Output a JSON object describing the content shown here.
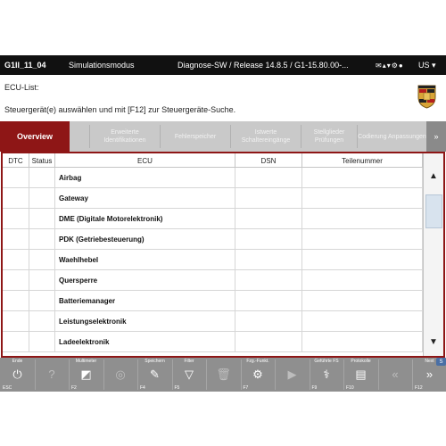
{
  "statusbar": {
    "vehicle": "G1II_11_04",
    "mode": "Simulationsmodus",
    "version": "Diagnose-SW / Release 14.8.5 / G1-15.80.00-...",
    "icons": "✉▴▾⚙●",
    "region": "US ▾"
  },
  "header": {
    "title": "ECU-List:",
    "instruction": "Steuergerät(e) auswählen und mit [F12] zur Steuergeräte-Suche.",
    "logo": "porsche-crest"
  },
  "tabs": [
    {
      "label": "Overview",
      "active": true
    },
    {
      "label": "",
      "active": false
    },
    {
      "label": "Erweiterte Identifikationen",
      "active": false
    },
    {
      "label": "Fehlerspeicher",
      "active": false
    },
    {
      "label": "Istwerte Schaltereingänge",
      "active": false
    },
    {
      "label": "Stellglieder Prüfungen",
      "active": false
    },
    {
      "label": "Codierung Anpassungen",
      "active": false
    }
  ],
  "tab_more": "»",
  "table": {
    "columns": [
      "DTC",
      "Status",
      "ECU",
      "DSN",
      "Teilenummer"
    ],
    "rows": [
      {
        "ecu": "Airbag"
      },
      {
        "ecu": "Gateway"
      },
      {
        "ecu": "DME (Digitale Motorelektronik)"
      },
      {
        "ecu": "PDK (Getriebesteuerung)"
      },
      {
        "ecu": "Waehlhebel"
      },
      {
        "ecu": "Quersperre"
      },
      {
        "ecu": "Batteriemanager"
      },
      {
        "ecu": "Leistungselektronik"
      },
      {
        "ecu": "Ladeelektronik"
      }
    ]
  },
  "toolbar": [
    {
      "label": "Ende",
      "key": "ESC",
      "icon": "power-icon",
      "glyph": "⏻",
      "enabled": true
    },
    {
      "label": "",
      "key": "",
      "icon": "help-icon",
      "glyph": "?",
      "enabled": false
    },
    {
      "label": "Multimeter",
      "key": "F2",
      "icon": "multimeter-icon",
      "glyph": "◩",
      "enabled": true
    },
    {
      "label": "",
      "key": "",
      "icon": "oscilloscope-icon",
      "glyph": "◎",
      "enabled": false
    },
    {
      "label": "Speichern",
      "key": "F4",
      "icon": "save-icon",
      "glyph": "✎",
      "enabled": true
    },
    {
      "label": "Filter",
      "key": "F5",
      "icon": "filter-icon",
      "glyph": "▽",
      "enabled": true
    },
    {
      "label": "",
      "key": "",
      "icon": "delete-icon",
      "glyph": "🗑",
      "enabled": false
    },
    {
      "label": "Fzg.-Funkt.",
      "key": "F7",
      "icon": "vehicle-functions-icon",
      "glyph": "⚙",
      "enabled": true
    },
    {
      "label": "",
      "key": "",
      "icon": "play-icon",
      "glyph": "▶",
      "enabled": false
    },
    {
      "label": "Geführte FS",
      "key": "F9",
      "icon": "guided-fault-finding-icon",
      "glyph": "⚕",
      "enabled": true
    },
    {
      "label": "Protokolle",
      "key": "F10",
      "icon": "protocol-icon",
      "glyph": "▤",
      "enabled": true
    },
    {
      "label": "",
      "key": "",
      "icon": "back-icon",
      "glyph": "«",
      "enabled": false
    },
    {
      "label": "Next",
      "key": "F12",
      "icon": "next-icon",
      "glyph": "»",
      "enabled": true
    }
  ],
  "corner_badge": "S",
  "colors": {
    "accent": "#8e1616",
    "statusbar": "#111111",
    "tabbar": "#c9c9c9",
    "toolbar": "#8f8f8f"
  }
}
